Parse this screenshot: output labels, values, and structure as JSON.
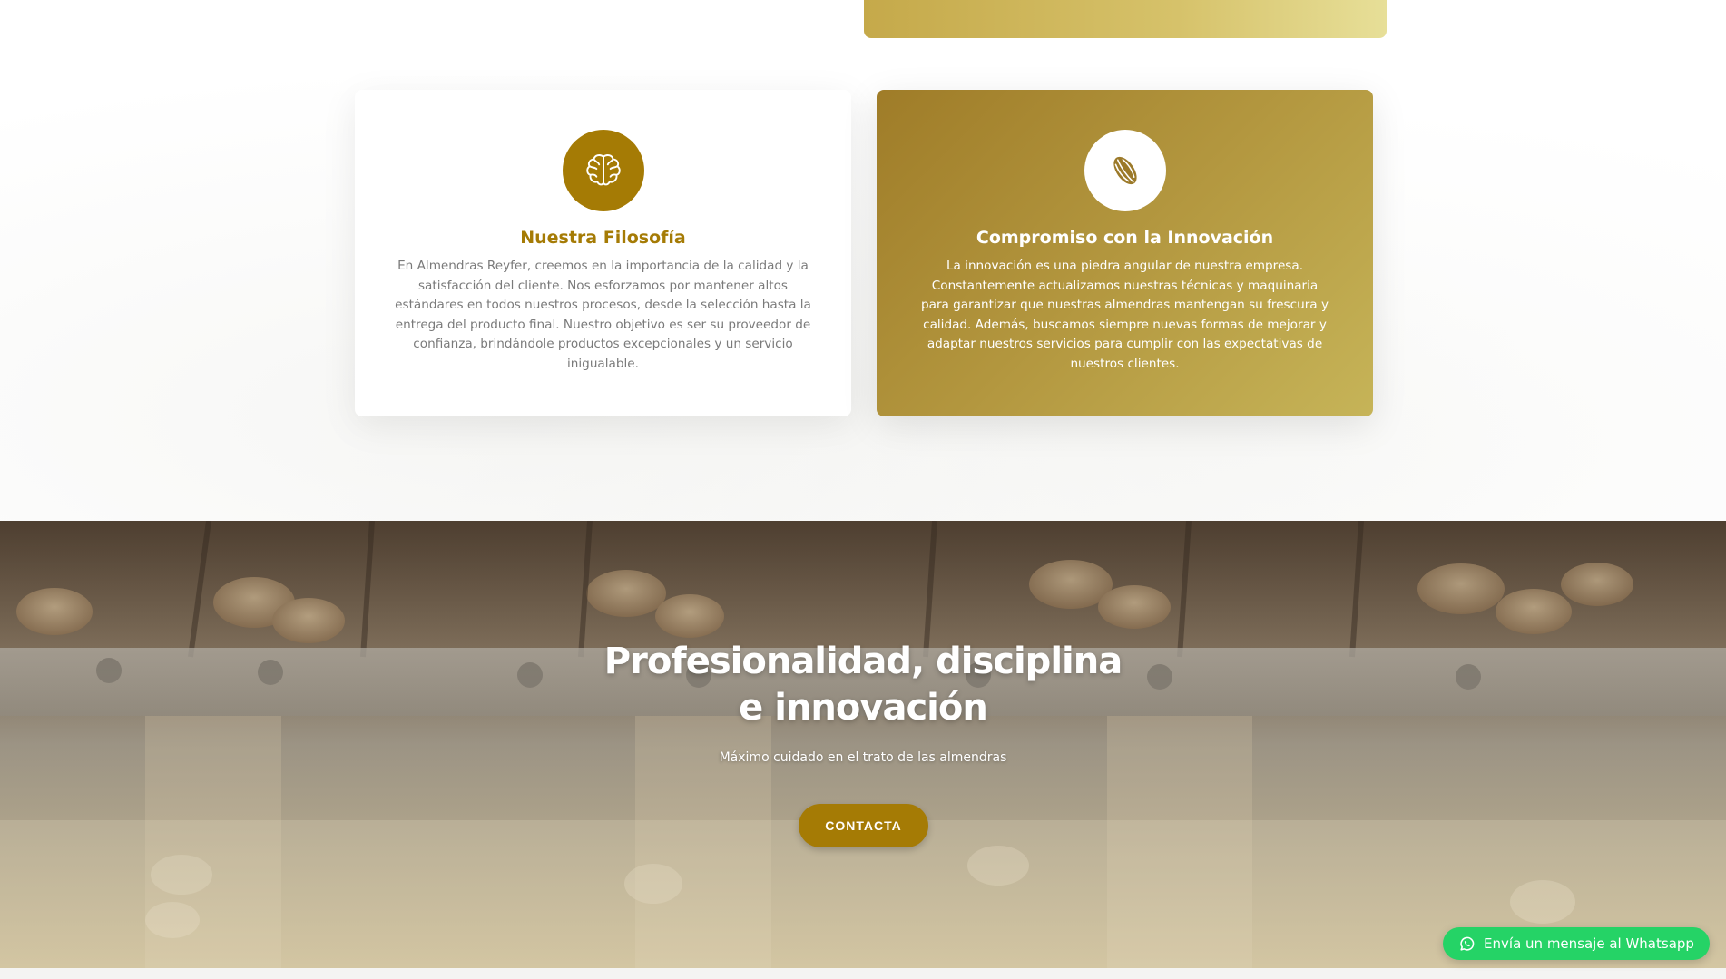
{
  "colors": {
    "brand_gold": "#a57b05",
    "whatsapp_green": "#25d366",
    "text_gray": "#7a7a7a"
  },
  "cards": [
    {
      "icon": "brain-icon",
      "title": "Nuestra Filosofía",
      "text": "En Almendras Reyfer, creemos en la importancia de la calidad y la satisfacción del cliente. Nos esforzamos por mantener altos estándares en todos nuestros procesos, desde la selección hasta la entrega del producto final. Nuestro objetivo es ser su proveedor de confianza, brindándole productos excepcionales y un servicio inigualable."
    },
    {
      "icon": "almond-icon",
      "title": "Compromiso con la Innovación",
      "text": "La innovación es una piedra angular de nuestra empresa. Constantemente actualizamos nuestras técnicas y maquinaria para garantizar que nuestras almendras mantengan su frescura y calidad. Además, buscamos siempre nuevas formas de mejorar y adaptar nuestros servicios para cumplir con las expectativas de nuestros clientes."
    }
  ],
  "hero": {
    "title": "Profesionalidad, disciplina e innovación",
    "subtitle": "Máximo cuidado en el trato de las almendras",
    "button_label": "CONTACTA"
  },
  "whatsapp": {
    "label": "Envía un mensaje al Whatsapp",
    "icon": "whatsapp-icon"
  }
}
